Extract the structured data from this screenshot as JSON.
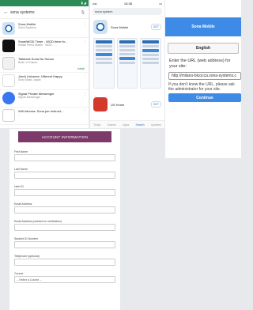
{
  "playstore": {
    "status_time": "",
    "search_query": "sona systems",
    "apps": [
      {
        "name": "Sona Mobile",
        "dev": "Sona Systems",
        "rating": "",
        "installed": ""
      },
      {
        "name": "SmartWOD Timer - WOD timer fo...",
        "dev": "Rafael Pérez Martín · WOD · ...",
        "rating": "",
        "installed": ""
      },
      {
        "name": "Talkback Sona No Sonan",
        "dev": "Brain 'n' Ensure",
        "rating": "",
        "installed": "Install"
      },
      {
        "name": "JoinA Universe: Ufferent Happy",
        "dev": "Sony Music Japan",
        "rating": "",
        "installed": ""
      },
      {
        "name": "Signal Private Messenger",
        "dev": "Signal Messenger",
        "rating": "",
        "installed": ""
      },
      {
        "name": "Wifi Informa: Sona per Instruct...",
        "dev": "...",
        "rating": "",
        "installed": ""
      }
    ]
  },
  "appstore": {
    "time": "13:35",
    "search_query": "sona system",
    "app1_name": "Sona Mobile",
    "get_label": "GET",
    "app2_name": "US Home",
    "tabs": [
      "Today",
      "Games",
      "Apps",
      "Search",
      "Updates"
    ]
  },
  "sona_login": {
    "title": "Sona Mobile",
    "language": "English",
    "enter_url_text": "Enter the URL (web address) for your site:",
    "url_value": "http://milano-bicocca.sona-systems.c",
    "help_text": "If you don't know the URL, please ask the administrator for your site.",
    "continue_label": "Continue"
  },
  "account_form": {
    "header": "ACCOUNT INFORMATION",
    "fields": [
      {
        "label": "First Name"
      },
      {
        "label": "Last Name"
      },
      {
        "label": "User ID"
      },
      {
        "label": "Email Address"
      },
      {
        "label": "Email Address (needed for verification)"
      },
      {
        "label": "Student ID Number"
      },
      {
        "label": "Telephone (optional)"
      }
    ],
    "course_label": "Course",
    "course_value": "-- Select a Course --"
  }
}
